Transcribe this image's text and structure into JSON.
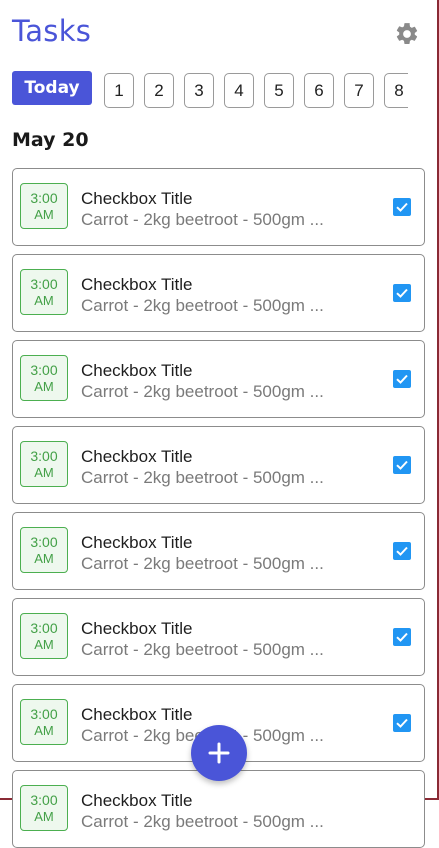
{
  "header": {
    "title": "Tasks",
    "settings_icon": "gear-icon"
  },
  "date_strip": {
    "today_label": "Today",
    "days": [
      "1",
      "2",
      "3",
      "4",
      "5",
      "6",
      "7",
      "8"
    ]
  },
  "section": {
    "date": "May 20"
  },
  "tasks": [
    {
      "time": "3:00",
      "period": "AM",
      "title": "Checkbox Title",
      "desc": "Carrot - 2kg beetroot - 500gm ...",
      "checked": true
    },
    {
      "time": "3:00",
      "period": "AM",
      "title": "Checkbox Title",
      "desc": "Carrot - 2kg beetroot - 500gm ...",
      "checked": true
    },
    {
      "time": "3:00",
      "period": "AM",
      "title": "Checkbox Title",
      "desc": "Carrot - 2kg beetroot - 500gm ...",
      "checked": true
    },
    {
      "time": "3:00",
      "period": "AM",
      "title": "Checkbox Title",
      "desc": "Carrot - 2kg beetroot - 500gm ...",
      "checked": true
    },
    {
      "time": "3:00",
      "period": "AM",
      "title": "Checkbox Title",
      "desc": "Carrot - 2kg beetroot - 500gm ...",
      "checked": true
    },
    {
      "time": "3:00",
      "period": "AM",
      "title": "Checkbox Title",
      "desc": "Carrot - 2kg beetroot - 500gm ...",
      "checked": true
    },
    {
      "time": "3:00",
      "period": "AM",
      "title": "Checkbox Title",
      "desc": "Carrot - 2kg beetroot - 500gm ...",
      "checked": true
    },
    {
      "time": "3:00",
      "period": "AM",
      "title": "Checkbox Title",
      "desc": "Carrot - 2kg beetroot - 500gm ...",
      "checked": false
    }
  ],
  "fab": {
    "icon": "plus-icon"
  },
  "colors": {
    "accent": "#4a55d8",
    "time_badge": "#43a047",
    "checkbox": "#2196f3"
  }
}
